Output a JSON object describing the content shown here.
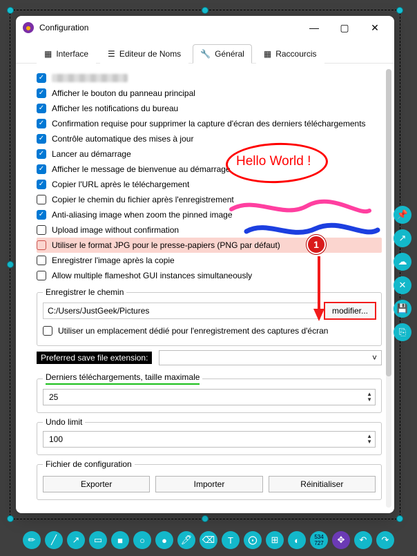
{
  "window": {
    "title": "Configuration",
    "minimize_glyph": "—",
    "maximize_glyph": "▢",
    "close_glyph": "✕"
  },
  "tabs": [
    {
      "icon": "layout-icon",
      "label": "Interface"
    },
    {
      "icon": "text-icon",
      "label": "Editeur de Noms"
    },
    {
      "icon": "wrench-icon",
      "label": "Général",
      "active": true
    },
    {
      "icon": "grid-icon",
      "label": "Raccourcis"
    }
  ],
  "options": [
    {
      "checked": true,
      "blurred": true
    },
    {
      "checked": true,
      "label": "Afficher le bouton du panneau principal"
    },
    {
      "checked": true,
      "label": "Afficher les notifications du bureau"
    },
    {
      "checked": true,
      "label": "Confirmation requise pour supprimer la capture d'écran des derniers téléchargements"
    },
    {
      "checked": true,
      "label": "Contrôle automatique des mises à jour"
    },
    {
      "checked": true,
      "label": "Lancer au démarrage"
    },
    {
      "checked": true,
      "label": "Afficher le message de bienvenue au démarrage"
    },
    {
      "checked": true,
      "label": "Copier l'URL après le téléchargement"
    },
    {
      "checked": false,
      "label": "Copier le chemin du fichier après l'enregistrement"
    },
    {
      "checked": true,
      "label": "Anti-aliasing image when zoom the pinned image"
    },
    {
      "checked": false,
      "label": "Upload image without confirmation"
    },
    {
      "checked": false,
      "highlight": true,
      "label": "Utiliser le format JPG pour le presse-papiers (PNG par défaut)"
    },
    {
      "checked": false,
      "label": "Enregistrer l'image après la copie"
    },
    {
      "checked": false,
      "label": "Allow multiple flameshot GUI instances simultaneously"
    }
  ],
  "save_path": {
    "legend": "Enregistrer le chemin",
    "path": "C:/Users/JustGeek/Pictures",
    "modify": "modifier...",
    "dedicated_location": "Utiliser un emplacement dédié pour l'enregistrement des captures d'écran"
  },
  "preferred_ext": {
    "label": "Preferred save file extension:",
    "value": ""
  },
  "recent": {
    "legend": "Derniers téléchargements, taille maximale",
    "value": "25"
  },
  "undo": {
    "legend": "Undo limit",
    "value": "100"
  },
  "config": {
    "legend": "Fichier de configuration",
    "export": "Exporter",
    "import": "Importer",
    "reset": "Réinitialiser"
  },
  "annotations": {
    "hello": "Hello World !",
    "badge": "1"
  },
  "side_icons": [
    "📌",
    "↗",
    "☁",
    "✕",
    "💾",
    "⎘"
  ],
  "toolbar_icons": [
    "✏",
    "╱",
    "↗",
    "▭",
    "■",
    "○",
    "●",
    "🖊",
    "⌫",
    "T",
    "⨀",
    "⊞",
    "◐"
  ],
  "toolbar_size": "534\n727",
  "toolbar_tail": [
    "✥",
    "↶",
    "↷"
  ]
}
